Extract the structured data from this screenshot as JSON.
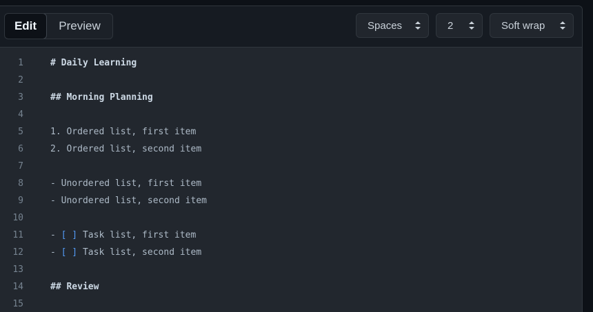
{
  "tabs": {
    "edit": "Edit",
    "preview": "Preview"
  },
  "options": {
    "indent_mode": "Spaces",
    "indent_size": "2",
    "wrap_mode": "Soft wrap"
  },
  "lines": [
    {
      "n": "1",
      "text": "# Daily Learning"
    },
    {
      "n": "2",
      "text": ""
    },
    {
      "n": "3",
      "text": "## Morning Planning"
    },
    {
      "n": "4",
      "text": ""
    },
    {
      "n": "5",
      "text": "1. Ordered list, first item"
    },
    {
      "n": "6",
      "text": "2. Ordered list, second item"
    },
    {
      "n": "7",
      "text": ""
    },
    {
      "n": "8",
      "text": "- Unordered list, first item"
    },
    {
      "n": "9",
      "text": "- Unordered list, second item"
    },
    {
      "n": "10",
      "text": ""
    },
    {
      "n": "11",
      "prefix": "- ",
      "checkbox": "[ ]",
      "rest": " Task list, first item"
    },
    {
      "n": "12",
      "prefix": "- ",
      "checkbox": "[ ]",
      "rest": " Task list, second item"
    },
    {
      "n": "13",
      "text": ""
    },
    {
      "n": "14",
      "text": "## Review"
    },
    {
      "n": "15",
      "text": ""
    }
  ]
}
